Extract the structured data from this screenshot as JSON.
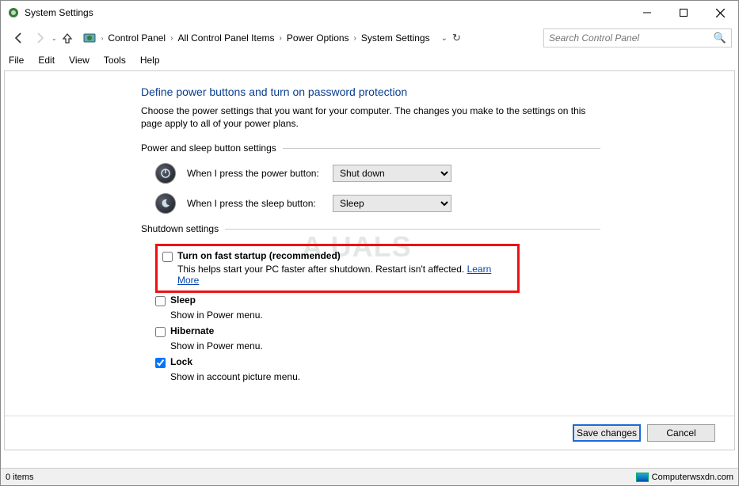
{
  "window": {
    "title": "System Settings"
  },
  "breadcrumb": {
    "items": [
      "Control Panel",
      "All Control Panel Items",
      "Power Options",
      "System Settings"
    ]
  },
  "search": {
    "placeholder": "Search Control Panel"
  },
  "menu": {
    "file": "File",
    "edit": "Edit",
    "view": "View",
    "tools": "Tools",
    "help": "Help"
  },
  "page": {
    "title": "Define power buttons and turn on password protection",
    "desc": "Choose the power settings that you want for your computer. The changes you make to the settings on this page apply to all of your power plans.",
    "section1": "Power and sleep button settings",
    "power_label": "When I press the power button:",
    "power_value": "Shut down",
    "sleep_label": "When I press the sleep button:",
    "sleep_value": "Sleep",
    "section2": "Shutdown settings",
    "fast_startup_label": "Turn on fast startup (recommended)",
    "fast_startup_desc": "This helps start your PC faster after shutdown. Restart isn't affected. ",
    "learn_more": "Learn More",
    "sleep_opt": "Sleep",
    "sleep_opt_desc": "Show in Power menu.",
    "hibernate_opt": "Hibernate",
    "hibernate_opt_desc": "Show in Power menu.",
    "lock_opt": "Lock",
    "lock_opt_desc": "Show in account picture menu.",
    "save": "Save changes",
    "cancel": "Cancel"
  },
  "status": {
    "left": "0 items",
    "right": "Computerwsxdn.com"
  },
  "watermark": "A   UALS"
}
